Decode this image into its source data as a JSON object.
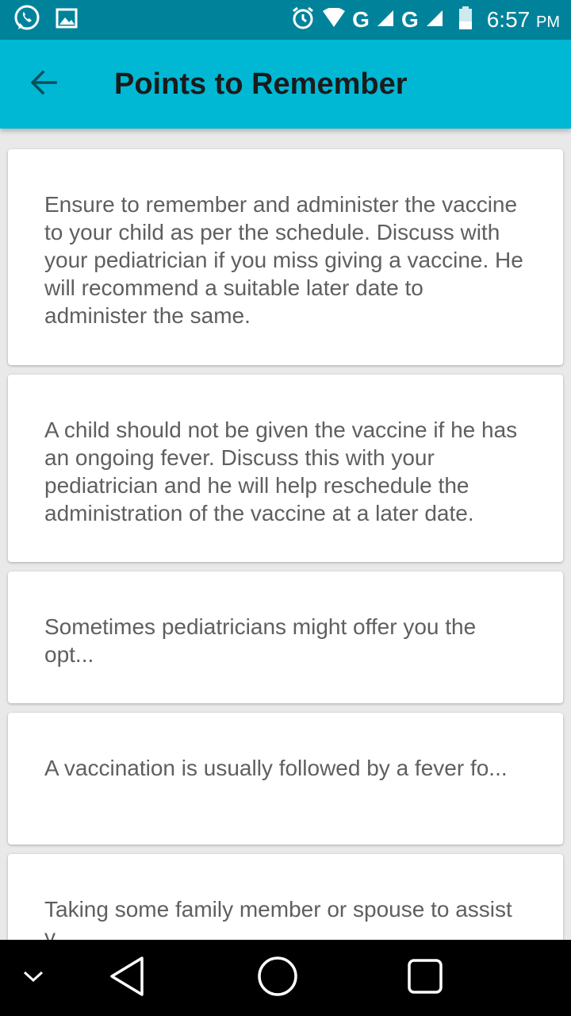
{
  "status_bar": {
    "network_1": "G",
    "network_2": "G",
    "time": "6:57",
    "ampm": "PM"
  },
  "app_bar": {
    "title": "Points to Remember"
  },
  "cards": [
    {
      "text": "Ensure to remember and administer the vaccine to your child as per the schedule. Discuss with your pediatrician if you miss giving a vaccine. He will recommend a suitable later date to administer the same."
    },
    {
      "text": "A child should not be given the vaccine if he has an ongoing fever. Discuss this with your pediatrician and he will help reschedule the administration of the vaccine at a later date."
    },
    {
      "text": "Sometimes pediatricians might offer you the opt..."
    },
    {
      "text": "A vaccination is usually followed by a fever fo..."
    },
    {
      "text": "Taking some family member or spouse to assist y..."
    }
  ],
  "colors": {
    "status_bar": "#00839a",
    "app_bar": "#00b8d4",
    "background": "#e9e9e9"
  },
  "icons": {
    "status_left": [
      "whatsapp-icon",
      "gallery-icon"
    ],
    "status_right": [
      "alarm-icon",
      "wifi-icon",
      "signal-icon",
      "battery-icon"
    ],
    "nav": [
      "chevron-down-icon",
      "back-triangle-icon",
      "home-circle-icon",
      "recents-square-icon"
    ]
  }
}
